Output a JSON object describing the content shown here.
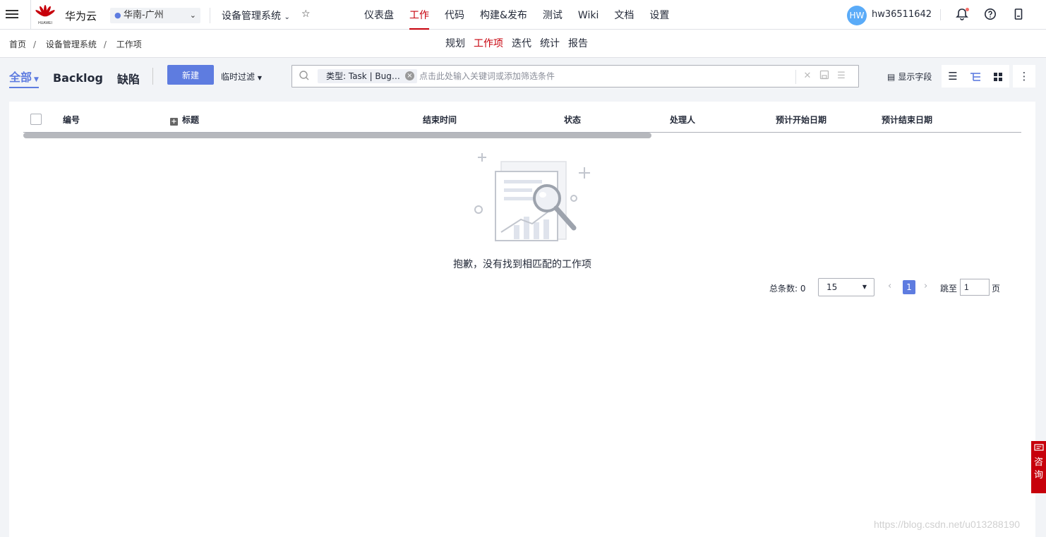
{
  "topbar": {
    "brand": "华为云",
    "logo_text": "HUAWEI",
    "region": "华南-广州",
    "project": "设备管理系统",
    "nav": [
      "仪表盘",
      "工作",
      "代码",
      "构建&发布",
      "测试",
      "Wiki",
      "文档",
      "设置"
    ],
    "active_nav": "工作",
    "avatar_initials": "HW",
    "username": "hw36511642"
  },
  "breadcrumb": [
    "首页",
    "设备管理系统",
    "工作项"
  ],
  "subnav": [
    "规划",
    "工作项",
    "迭代",
    "统计",
    "报告"
  ],
  "active_subnav": "工作项",
  "toolbar": {
    "views": [
      "全部",
      "Backlog",
      "缺陷"
    ],
    "new_button": "新建",
    "temp_filter": "临时过滤",
    "filter_chip": "类型: Task | Bug…",
    "search_placeholder": "点击此处输入关键词或添加筛选条件",
    "show_fields": "显示字段"
  },
  "table": {
    "columns": [
      "编号",
      "标题",
      "结束时间",
      "状态",
      "处理人",
      "预计开始日期",
      "预计结束日期"
    ],
    "rows": []
  },
  "empty_message": "抱歉，没有找到相匹配的工作项",
  "pagination": {
    "total_label": "总条数: 0",
    "page_size": "15",
    "current_page": "1",
    "jump_label": "跳至",
    "jump_value": "1",
    "page_unit": "页"
  },
  "consult": "咨询",
  "watermark": "https://blog.csdn.net/u013288190",
  "colors": {
    "accent": "#5e7ce0",
    "brand_red": "#c7000b"
  }
}
